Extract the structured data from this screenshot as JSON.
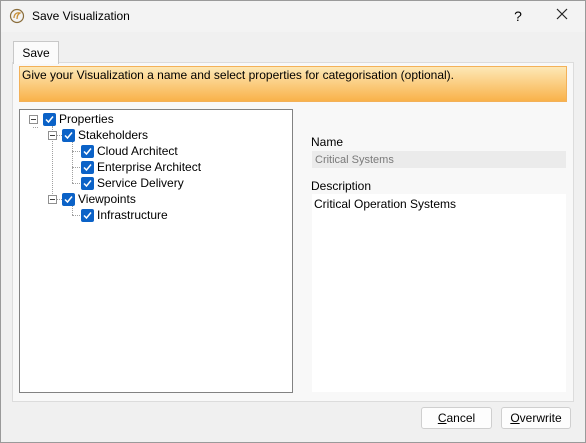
{
  "window": {
    "title": "Save Visualization",
    "help_label": "?"
  },
  "tabs": [
    {
      "label": "Save"
    }
  ],
  "banner": {
    "text": "Give your Visualization a name and select properties for categorisation (optional)."
  },
  "tree": {
    "root": {
      "label": "Properties",
      "checked": true,
      "expanded": true
    },
    "stakeholders": {
      "label": "Stakeholders",
      "checked": true,
      "expanded": true
    },
    "cloud_architect": {
      "label": "Cloud Architect",
      "checked": true
    },
    "enterprise_architect": {
      "label": "Enterprise Architect",
      "checked": true
    },
    "service_delivery": {
      "label": "Service Delivery",
      "checked": true
    },
    "viewpoints": {
      "label": "Viewpoints",
      "checked": true,
      "expanded": true
    },
    "infrastructure": {
      "label": "Infrastructure",
      "checked": true
    }
  },
  "details": {
    "name_label": "Name",
    "name_value": "Critical Systems",
    "description_label": "Description",
    "description_value": "Critical Operation Systems"
  },
  "buttons": {
    "cancel_rest": "ancel",
    "cancel_mnemonic": "C",
    "overwrite_rest": "verwrite",
    "overwrite_mnemonic": "O"
  },
  "colors": {
    "accent": "#0b62c7",
    "banner_top": "#fde8b6",
    "banner_bottom": "#f9b24a"
  }
}
